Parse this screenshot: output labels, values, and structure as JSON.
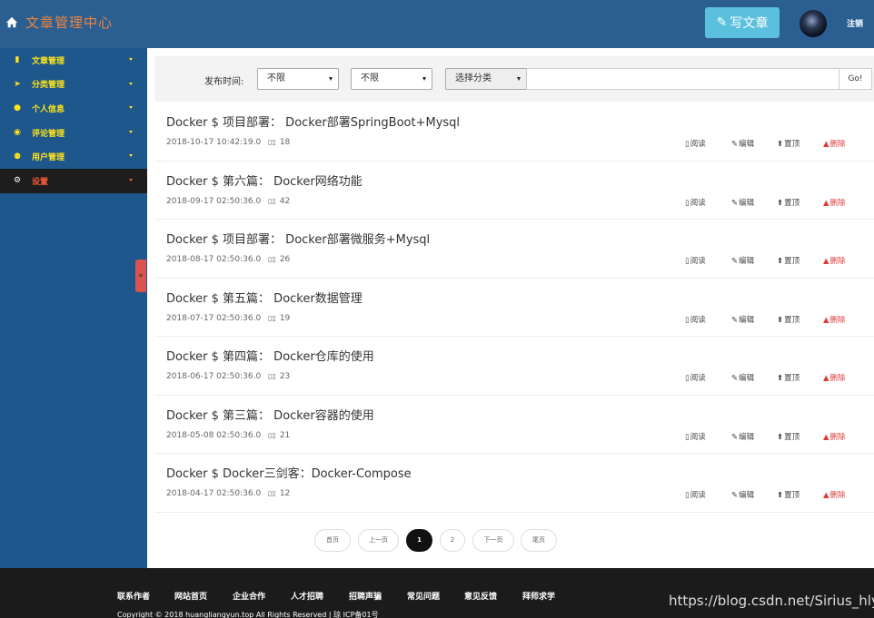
{
  "header": {
    "brand_title": "文章管理中心",
    "write_label": "写文章",
    "logout_label": "注销"
  },
  "sidebar": {
    "items": [
      {
        "label": "文章管理",
        "icon": "book-icon"
      },
      {
        "label": "分类管理",
        "icon": "paper-plane-icon"
      },
      {
        "label": "个人信息",
        "icon": "user-icon"
      },
      {
        "label": "评论管理",
        "icon": "comments-icon"
      },
      {
        "label": "用户管理",
        "icon": "users-icon"
      },
      {
        "label": "设置",
        "icon": "cogs-icon",
        "active": true
      }
    ],
    "collapse_label": "«"
  },
  "filter": {
    "label": "发布时间:",
    "select1": "不限",
    "select2": "不限",
    "select3": "选择分类",
    "search_value": "",
    "go_label": "Go!"
  },
  "articles": [
    {
      "title": "Docker $ 项目部署： Docker部署SpringBoot+Mysql",
      "date": "2018-10-17 10:42:19.0",
      "views": "18"
    },
    {
      "title": "Docker $ 第六篇： Docker网络功能",
      "date": "2018-09-17 02:50:36.0",
      "views": "42"
    },
    {
      "title": "Docker $ 项目部署： Docker部署微服务+Mysql",
      "date": "2018-08-17 02:50:36.0",
      "views": "26"
    },
    {
      "title": "Docker $ 第五篇： Docker数据管理",
      "date": "2018-07-17 02:50:36.0",
      "views": "19"
    },
    {
      "title": "Docker $ 第四篇： Docker仓库的使用",
      "date": "2018-06-17 02:50:36.0",
      "views": "23"
    },
    {
      "title": "Docker $ 第三篇： Docker容器的使用",
      "date": "2018-05-08 02:50:36.0",
      "views": "21"
    },
    {
      "title": "Docker $ Docker三剑客：Docker-Compose",
      "date": "2018-04-17 02:50:36.0",
      "views": "12"
    }
  ],
  "actions": {
    "view": "阅读",
    "edit": "编辑",
    "top": "置顶",
    "delete": "删除"
  },
  "pagination": {
    "first": "首页",
    "prev": "上一页",
    "pages": [
      "1",
      "2"
    ],
    "current": "1",
    "next": "下一页",
    "last": "尾页"
  },
  "footer": {
    "links": [
      "联系作者",
      "网站首页",
      "企业合作",
      "人才招聘",
      "招聘声骗",
      "常见问题",
      "意见反馈",
      "拜师求学"
    ],
    "copyright": "Copyright © 2018  huangliangyun.top  All Rights Reserved | 琼 ICP备01号",
    "watermark": "https://blog.csdn.net/Sirius_hly"
  },
  "colors": {
    "header_bg": "#2b5f92",
    "sidebar_bg": "#1e578b",
    "menu_text": "#ffe419",
    "brand_text": "#f0833a",
    "write_button": "#5bc0de",
    "delete_text": "#e03a3a",
    "footer_bg": "#1b1b1b"
  }
}
